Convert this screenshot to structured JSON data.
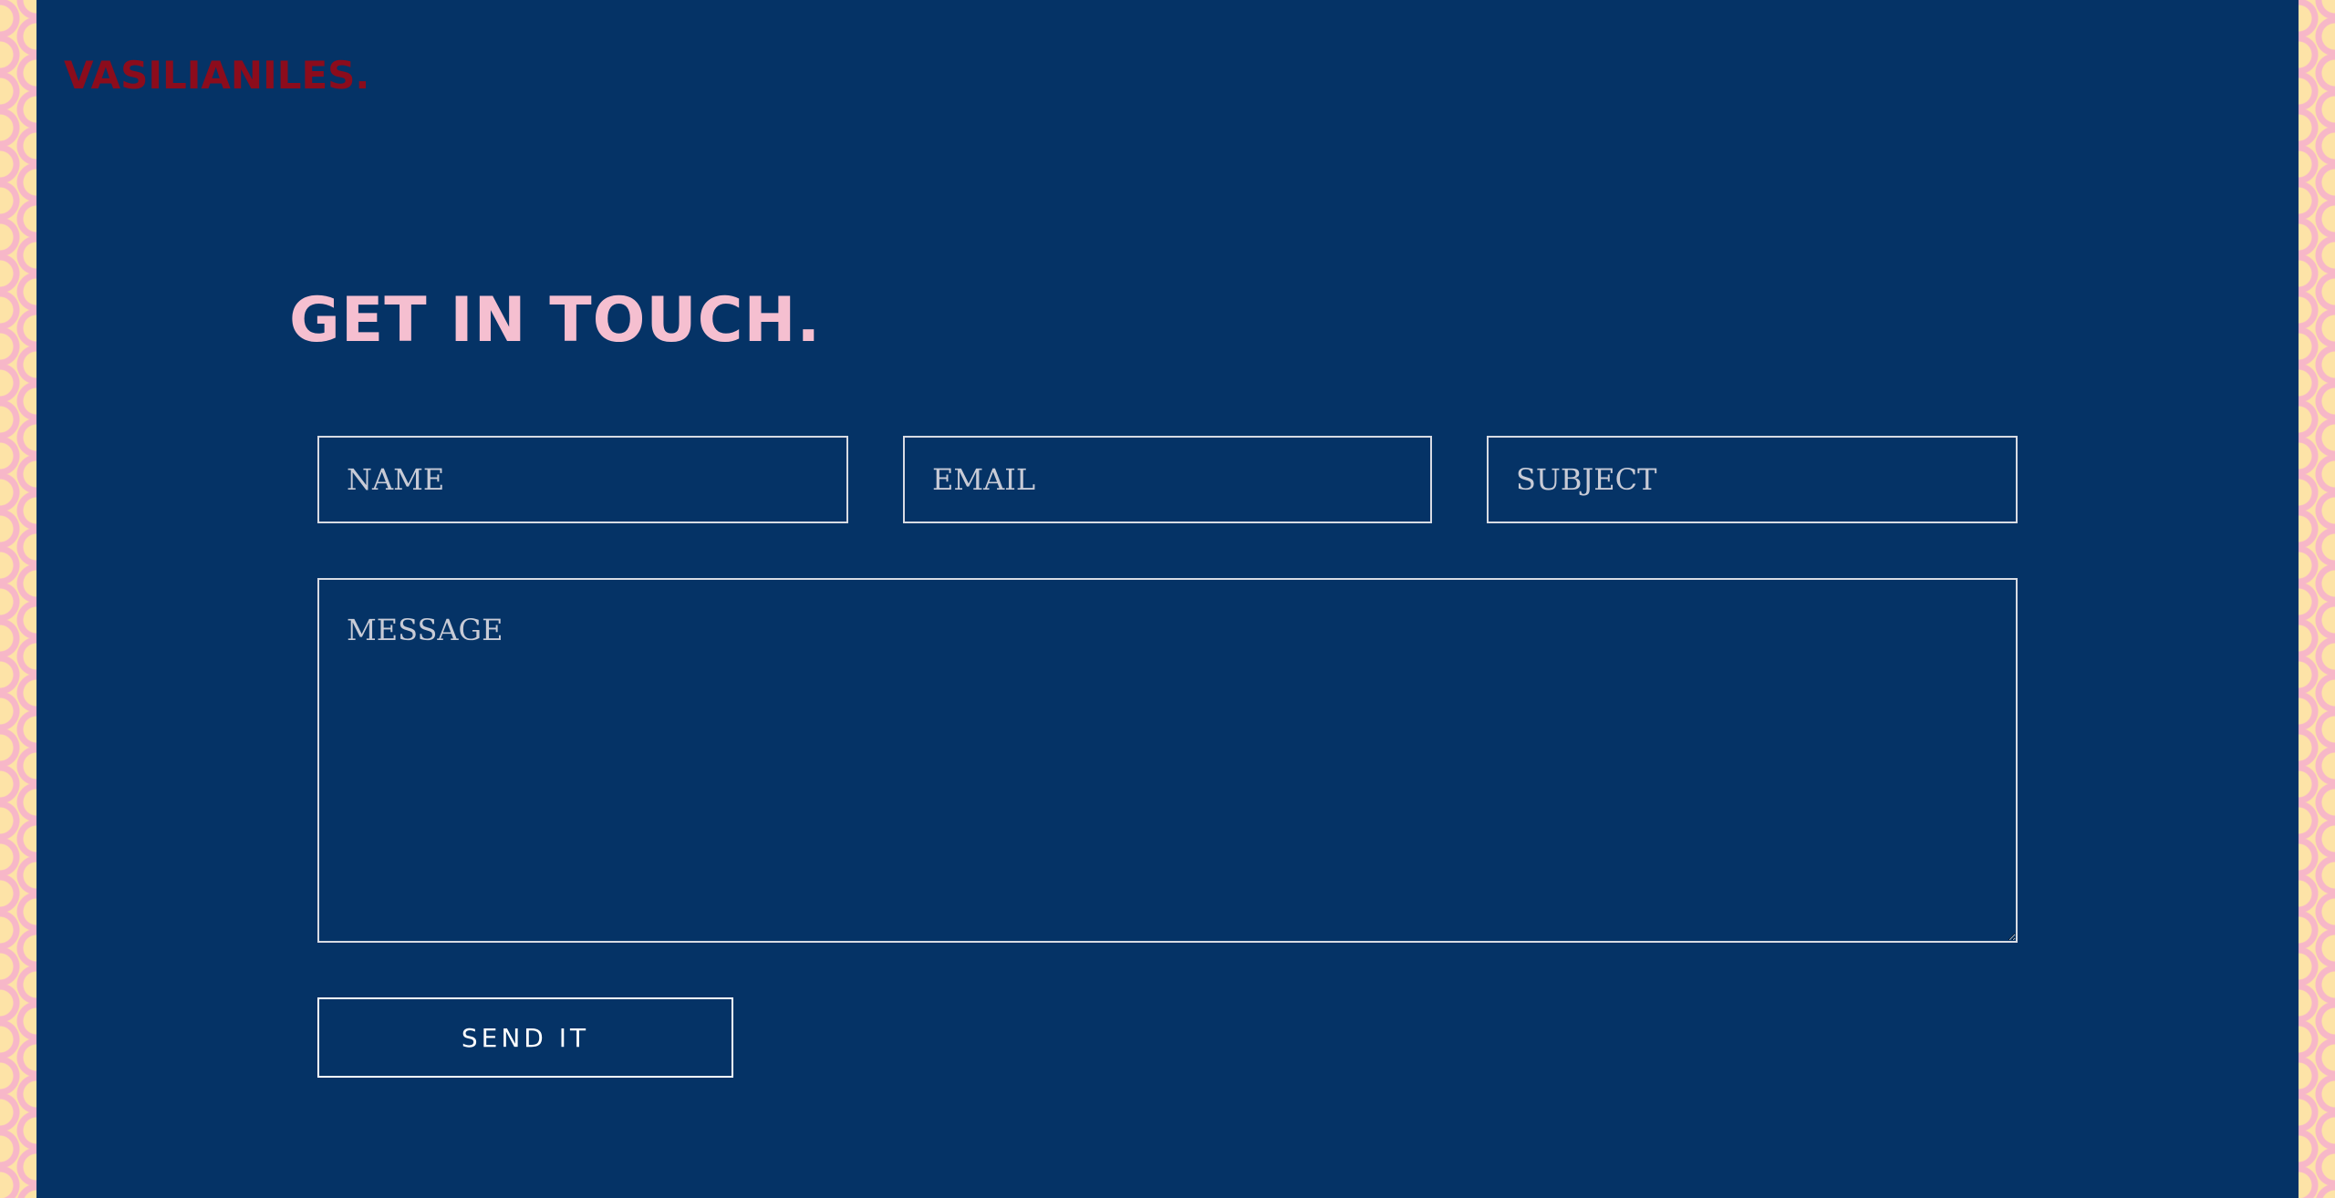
{
  "brand": {
    "name": "VASILIANILES."
  },
  "contact": {
    "heading": "GET IN TOUCH.",
    "fields": {
      "name_placeholder": "NAME",
      "email_placeholder": "EMAIL",
      "subject_placeholder": "SUBJECT",
      "message_placeholder": "MESSAGE"
    },
    "submit_label": "SEND IT"
  },
  "colors": {
    "background": "#053366",
    "brand": "#8c0c1c",
    "heading": "#f5bfd0",
    "field_border": "#d8dbe3",
    "border_pattern_pink": "#f7b7c8",
    "border_pattern_cream": "#fde3a7"
  }
}
